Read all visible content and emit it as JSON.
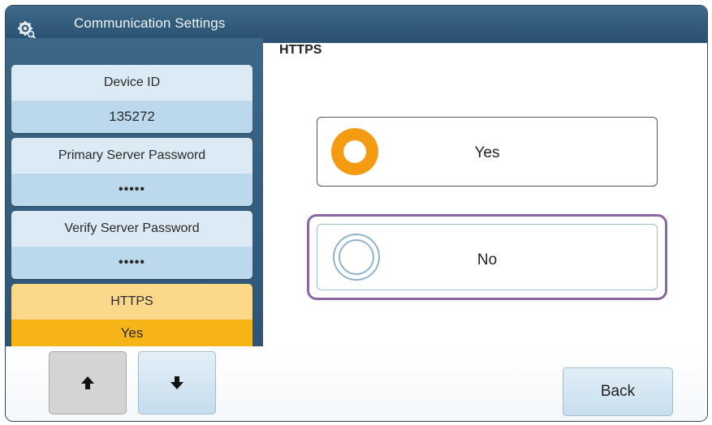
{
  "header": {
    "title": "Communication Settings",
    "icon": "gear-search-icon"
  },
  "section": {
    "title": "HTTPS"
  },
  "settings_list": [
    {
      "label": "Device ID",
      "value": "135272",
      "active": false
    },
    {
      "label": "Primary Server Password",
      "value": "•••••",
      "active": false
    },
    {
      "label": "Verify Server Password",
      "value": "•••••",
      "active": false
    },
    {
      "label": "HTTPS",
      "value": "Yes",
      "active": true
    }
  ],
  "options": [
    {
      "label": "Yes",
      "selected": true
    },
    {
      "label": "No",
      "selected": false,
      "focused": true
    }
  ],
  "nav": {
    "up_icon": "arrow-up-icon",
    "down_icon": "arrow-down-icon"
  },
  "footer": {
    "back_label": "Back"
  },
  "colors": {
    "header": "#2b5272",
    "card_top": "#dbeaf5",
    "card_bottom": "#bcd8ec",
    "active_top": "#fcd88a",
    "active_bottom": "#f6b416",
    "radio_selected": "#f39c12",
    "focus_outline": "#8a67a2"
  }
}
